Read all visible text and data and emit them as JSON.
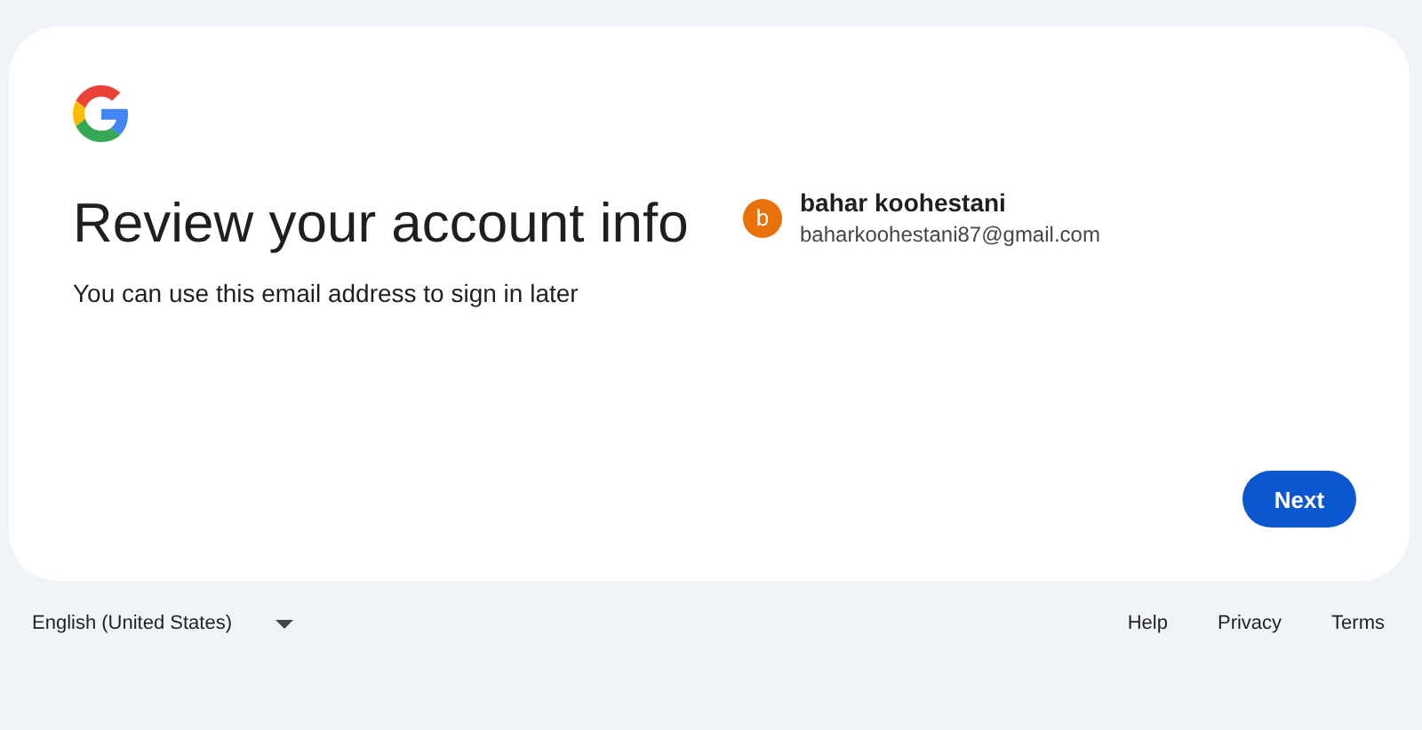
{
  "card": {
    "title": "Review your account info",
    "subtitle": "You can use this email address to sign in later",
    "account": {
      "initial": "b",
      "name": "bahar koohestani",
      "email": "baharkoohestani87@gmail.com"
    },
    "buttons": [
      "Next"
    ]
  },
  "footer": {
    "language": "English (United States)",
    "links": [
      "Help",
      "Privacy",
      "Terms"
    ]
  }
}
